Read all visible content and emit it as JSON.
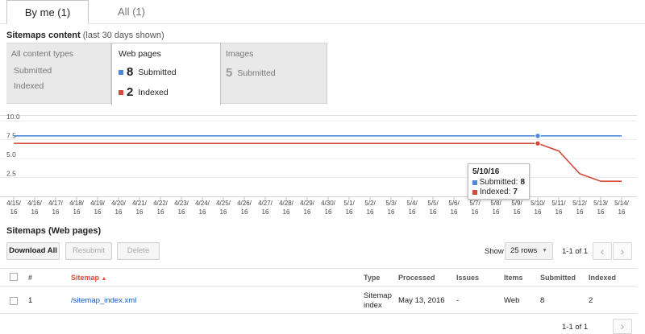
{
  "tabs": [
    {
      "label": "By me (1)",
      "active": true
    },
    {
      "label": "All (1)",
      "active": false
    }
  ],
  "sitemaps_content": {
    "title": "Sitemaps content",
    "subtitle": "(last 30 days shown)"
  },
  "content_types": {
    "all": {
      "title": "All content types",
      "submitted_label": "Submitted",
      "indexed_label": "Indexed"
    },
    "web": {
      "title": "Web pages",
      "submitted": "8",
      "submitted_label": "Submitted",
      "indexed": "2",
      "indexed_label": "Indexed"
    },
    "images": {
      "title": "Images",
      "submitted": "5",
      "submitted_label": "Submitted"
    }
  },
  "colors": {
    "submitted": "#4a89dc",
    "indexed": "#d44b3c",
    "link": "#1155cc",
    "sort_active": "#dd4b39"
  },
  "chart_data": {
    "type": "line",
    "x": [
      "4/15/16",
      "4/16/16",
      "4/17/16",
      "4/18/16",
      "4/19/16",
      "4/20/16",
      "4/21/16",
      "4/22/16",
      "4/23/16",
      "4/24/16",
      "4/25/16",
      "4/26/16",
      "4/27/16",
      "4/28/16",
      "4/29/16",
      "4/30/16",
      "5/1/16",
      "5/2/16",
      "5/3/16",
      "5/4/16",
      "5/5/16",
      "5/6/16",
      "5/7/16",
      "5/8/16",
      "5/9/16",
      "5/10/16",
      "5/11/16",
      "5/12/16",
      "5/13/16",
      "5/14/16"
    ],
    "x_tick_top": [
      "4/15/",
      "4/16/",
      "4/17/",
      "4/18/",
      "4/19/",
      "4/20/",
      "4/21/",
      "4/22/",
      "4/23/",
      "4/24/",
      "4/25/",
      "4/26/",
      "4/27/",
      "4/28/",
      "4/29/",
      "4/30/",
      "5/1/",
      "5/2/",
      "5/3/",
      "5/4/",
      "5/5/",
      "5/6/",
      "5/7/",
      "5/8/",
      "5/9/",
      "5/10/",
      "5/11/",
      "5/12/",
      "5/13/",
      "5/14/"
    ],
    "x_tick_bottom": "16",
    "series": [
      {
        "name": "Submitted",
        "values": [
          8,
          8,
          8,
          8,
          8,
          8,
          8,
          8,
          8,
          8,
          8,
          8,
          8,
          8,
          8,
          8,
          8,
          8,
          8,
          8,
          8,
          8,
          8,
          8,
          8,
          8,
          8,
          8,
          8,
          8
        ]
      },
      {
        "name": "Indexed",
        "values": [
          7,
          7,
          7,
          7,
          7,
          7,
          7,
          7,
          7,
          7,
          7,
          7,
          7,
          7,
          7,
          7,
          7,
          7,
          7,
          7,
          7,
          7,
          7,
          7,
          7,
          7,
          6,
          3,
          2,
          2
        ]
      }
    ],
    "y_ticks": [
      "10.0",
      "7.5",
      "5.0",
      "2.5"
    ],
    "ylim": [
      0,
      10
    ],
    "highlight_index": 25,
    "grid": true
  },
  "tooltip": {
    "date": "5/10/16",
    "submitted_label": "Submitted:",
    "submitted_value": "8",
    "indexed_label": "Indexed:",
    "indexed_value": "7"
  },
  "sitemaps_section": {
    "title": "Sitemaps (Web pages)"
  },
  "toolbar": {
    "download_all": "Download All",
    "resubmit": "Resubmit",
    "delete": "Delete"
  },
  "pagination": {
    "show_label": "Show",
    "rows_option": "25 rows",
    "range_text": "1-1 of 1"
  },
  "table": {
    "headers": {
      "num": "#",
      "sitemap": "Sitemap",
      "type": "Type",
      "processed": "Processed",
      "issues": "Issues",
      "items": "Items",
      "submitted": "Submitted",
      "indexed": "Indexed"
    },
    "sort_indicator": "▲",
    "rows": [
      {
        "num": "1",
        "sitemap": "/sitemap_index.xml",
        "type_line1": "Sitemap",
        "type_line2": "index",
        "processed": "May 13, 2016",
        "issues": "-",
        "items": "Web",
        "submitted": "8",
        "indexed": "2"
      }
    ]
  },
  "icons": {
    "prev": "chevron-left-icon",
    "next": "chevron-right-icon",
    "caret": "caret-down-icon"
  }
}
